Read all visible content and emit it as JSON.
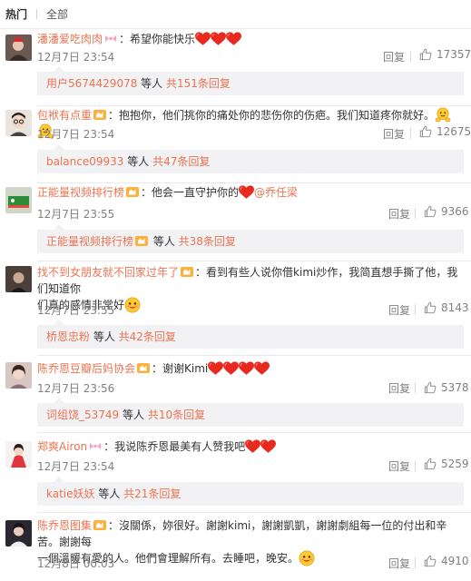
{
  "tabs": [
    {
      "label": "热门"
    },
    {
      "label": "全部"
    }
  ],
  "comments": [
    {
      "user": "潘潘爱吃肉肉",
      "sep": "：",
      "text": "希望你能快乐",
      "time": "12月7日 23:54",
      "reply": "回复",
      "likes": "17357",
      "sub": {
        "user": "用户5674429078",
        "mid": " 等人 ",
        "more": "共151条回复"
      }
    },
    {
      "user": "包袱有点重",
      "sep": "：",
      "text": "抱抱你，他们挑你的痛处你的悲伤你的伤疤。我们知道疼你就好。",
      "time": "12月7日 23:54",
      "reply": "回复",
      "likes": "12675",
      "sub": {
        "user": "balance09933",
        "mid": " 等人 ",
        "more": "共47条回复"
      }
    },
    {
      "user": "正能量视频排行榜",
      "sep": "：",
      "text": "他会一直守护你的",
      "mention": "@乔任梁",
      "time": "12月7日 23:55",
      "reply": "回复",
      "likes": "9366",
      "sub": {
        "user": "正能量视频排行榜",
        "mid": " 等人 ",
        "more": "共38条回复"
      }
    },
    {
      "user": "找不到女朋友就不回家过年了",
      "sep": "：",
      "text1": "看到有些人说你借kimi炒作，我简直想手撕了他，我们知道你",
      "text2": "们真的感情非常好",
      "time": "12月7日 23:55",
      "reply": "回复",
      "likes": "8143",
      "sub": {
        "user": "桥恩忠粉",
        "mid": " 等人 ",
        "more": "共42条回复"
      }
    },
    {
      "user": "陈乔恩豆瓣后妈协会",
      "sep": "：",
      "text": "谢谢Kimi",
      "time": "12月7日 23:56",
      "reply": "回复",
      "likes": "5378",
      "sub": {
        "user": "词组饶_53749",
        "mid": " 等人 ",
        "more": "共10条回复"
      }
    },
    {
      "user": "郑爽Airon",
      "sep": "：",
      "text": "我说陈乔恩最美有人赞我吧",
      "time": "12月7日 23:54",
      "reply": "回复",
      "likes": "5259",
      "sub": {
        "user": "katie妖妖",
        "mid": " 等人 ",
        "more": "共21条回复"
      }
    },
    {
      "user": "陈乔恩图集",
      "sep": "：",
      "text1": "沒關係，妳很好。謝謝kimi，謝謝凱凱，謝謝劇組每一位的付出和辛苦。謝謝每",
      "text2": "一個溫暖有愛的人。他們會理解所有。去睡吧，晚安。",
      "time": "12月8日 00:03",
      "reply": "回复",
      "likes": "4910"
    }
  ],
  "colors": {
    "username": "#eb7350",
    "meta": "#808080",
    "subbox": "#f2f2f5",
    "heart": "#e8291d"
  }
}
